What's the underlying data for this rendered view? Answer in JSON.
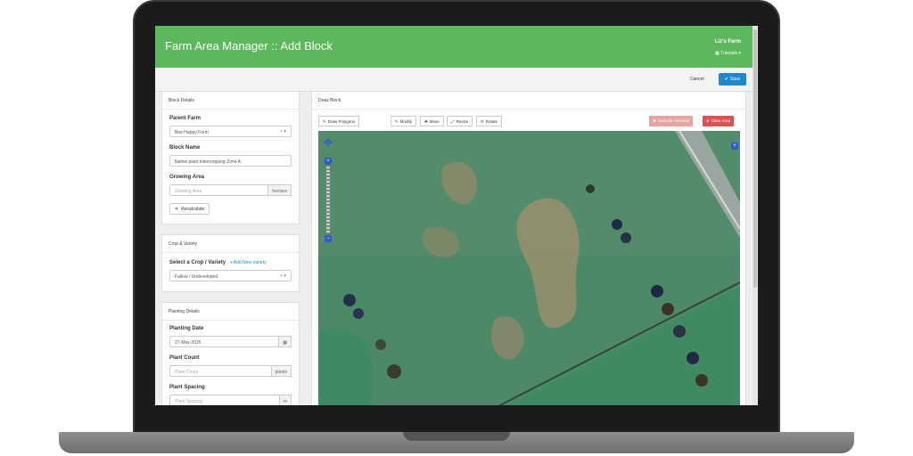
{
  "header": {
    "title": "Farm Area Manager :: Add Block",
    "farm_name": "Liz's Farm",
    "tutorials_label": "Tutorials"
  },
  "actions": {
    "cancel_label": "Cancel",
    "save_label": "Save"
  },
  "block_details": {
    "heading": "Block Details",
    "parent_farm_label": "Parent Farm",
    "parent_farm_value": "Bee Happy Farm",
    "block_name_label": "Block Name",
    "block_name_value": "Native plant intercropping Zone A",
    "growing_area_label": "Growing Area",
    "growing_area_placeholder": "Growing Area",
    "growing_area_unit": "hectare",
    "recalculate_label": "Recalculate"
  },
  "crop_variety": {
    "heading": "Crop & Variety",
    "select_label": "Select a Crop / Variety",
    "add_link": "+ Add New Variety",
    "value": "Fallow / Undeveloped"
  },
  "planting_details": {
    "heading": "Planting Details",
    "date_label": "Planting Date",
    "date_value": "27-May-2025",
    "count_label": "Plant Count",
    "count_placeholder": "Plant Count",
    "count_unit": "plants",
    "spacing_label": "Plant Spacing",
    "spacing_placeholder": "Plant Spacing",
    "spacing_unit": "m"
  },
  "draw_block": {
    "heading": "Draw Block",
    "draw_polygons": "Draw Polygons",
    "modify": "Modify",
    "move": "Move",
    "resize": "Resize",
    "rotate": "Rotate",
    "remove_selected": "Remove Selected",
    "clear_area": "Clear Area"
  },
  "colors": {
    "header": "#5cb85c",
    "primary": "#1e88c9",
    "danger": "#d9534f",
    "danger_light": "#e9a3a1"
  },
  "icons": [
    "pencil-icon",
    "move-icon",
    "resize-icon",
    "rotate-icon",
    "check-icon",
    "calendar-icon",
    "map-pan-icon",
    "zoom-in-icon",
    "zoom-out-icon"
  ]
}
